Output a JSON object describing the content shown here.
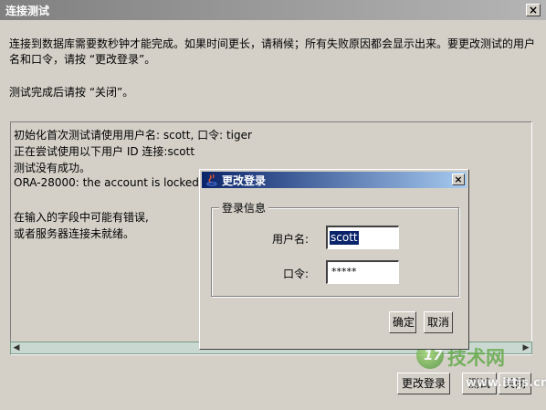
{
  "window": {
    "title": "连接测试",
    "close_glyph": "×"
  },
  "instructions": {
    "line1": "连接到数据库需要数秒钟才能完成。如果时间更长，请稍候；所有失败原因都会显示出来。要更改测试的用户",
    "line2": "名和口令，请按 “更改登录”。",
    "line3": "测试完成后请按 “关闭”。"
  },
  "results": {
    "lines": [
      "初始化首次测试请使用用户名: scott, 口令: tiger",
      "正在尝试使用以下用户 ID 连接:scott",
      "测试没有成功。",
      "ORA-28000: the account is locked",
      "",
      "在输入的字段中可能有错误,",
      "或者服务器连接未就绪。"
    ]
  },
  "buttons": {
    "change_login": "更改登录",
    "test": "测试",
    "close": "关闭"
  },
  "dialog": {
    "title": "更改登录",
    "close_glyph": "×",
    "group_label": "登录信息",
    "username_label": "用户名:",
    "username_value": "scott",
    "password_label": "口令:",
    "password_value": "*****",
    "ok": "确定",
    "cancel": "取消"
  },
  "watermark": {
    "logo_char": "17",
    "brand": "技术网",
    "url": "www.ittjs.cn"
  },
  "icons": {
    "dialog_icon": "java-icon"
  }
}
